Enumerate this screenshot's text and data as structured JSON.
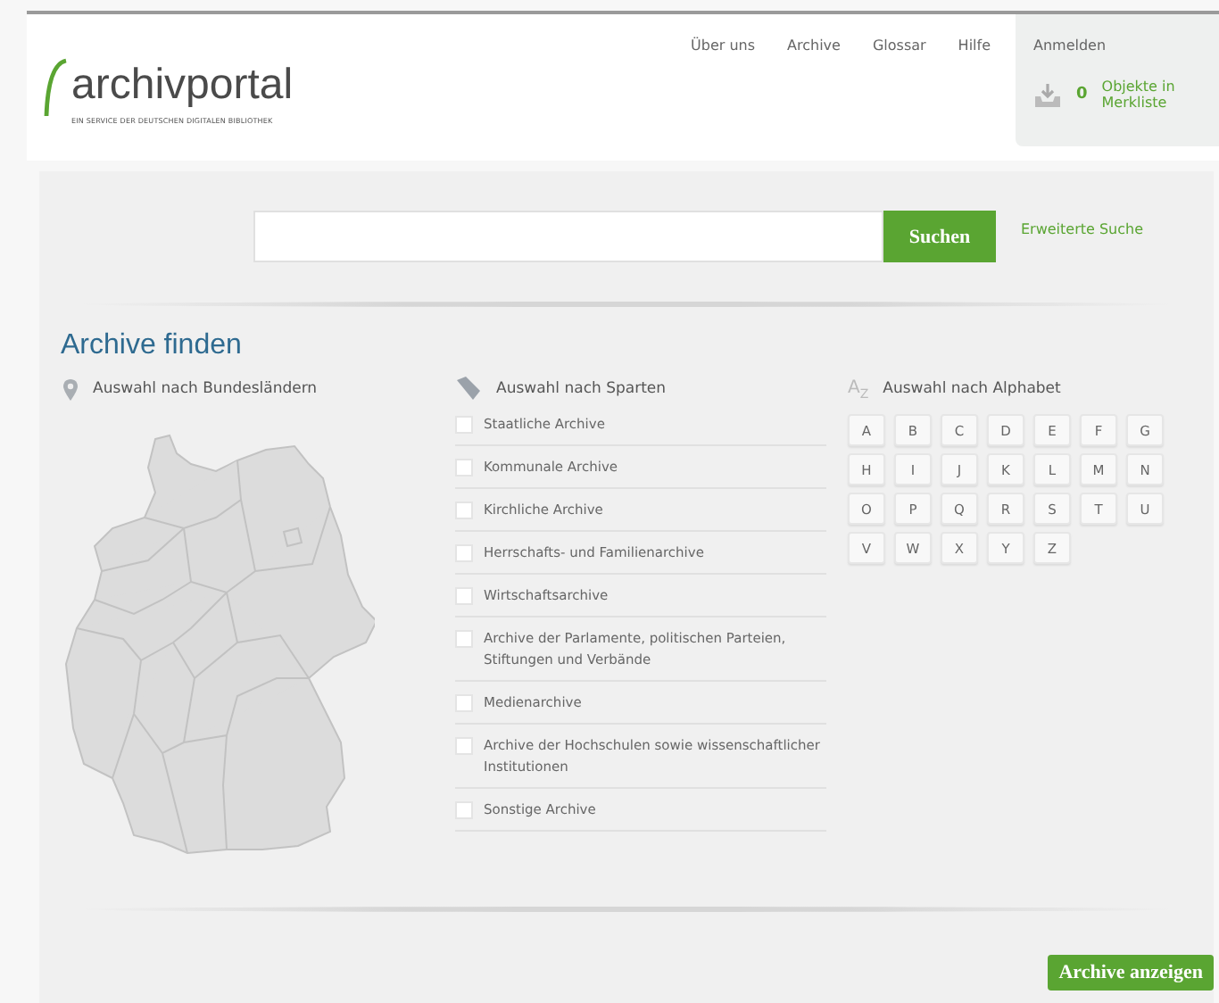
{
  "header": {
    "logo": "archivportal",
    "tagline": "EIN SERVICE DER DEUTSCHEN DIGITALEN BIBLIOTHEK",
    "nav": [
      "Über uns",
      "Archive",
      "Glossar",
      "Hilfe"
    ],
    "login": "Anmelden",
    "watchlist": {
      "count": "0",
      "label": "Objekte in Merkliste"
    }
  },
  "search": {
    "button": "Suchen",
    "advanced_link": "Erweiterte Suche"
  },
  "finder": {
    "title": "Archive finden",
    "states": {
      "heading": "Auswahl nach Bundesländern"
    },
    "sections": {
      "heading": "Auswahl nach Sparten",
      "items": [
        {
          "label": "Staatliche Archive",
          "checked": false
        },
        {
          "label": "Kommunale Archive",
          "checked": false
        },
        {
          "label": "Kirchliche Archive",
          "checked": false
        },
        {
          "label": "Herrschafts- und Familienarchive",
          "checked": false
        },
        {
          "label": "Wirtschaftsarchive",
          "checked": false
        },
        {
          "label": "Archive der Parlamente, politischen Parteien, Stiftungen und Verbände",
          "checked": false
        },
        {
          "label": "Medienarchive",
          "checked": false
        },
        {
          "label": "Archive der Hochschulen sowie wissenschaftlicher Institutionen",
          "checked": false
        },
        {
          "label": "Sonstige Archive",
          "checked": false
        }
      ]
    },
    "alphabet": {
      "icon_text": "A$_{Z}$",
      "heading": "Auswahl nach Alphabet",
      "letters": [
        "A",
        "B",
        "C",
        "D",
        "E",
        "F",
        "G",
        "H",
        "I",
        "J",
        "K",
        "L",
        "M",
        "N",
        "O",
        "P",
        "Q",
        "R",
        "S",
        "T",
        "U",
        "V",
        "W",
        "X",
        "Y",
        "Z"
      ]
    },
    "submit": "Archive anzeigen"
  }
}
